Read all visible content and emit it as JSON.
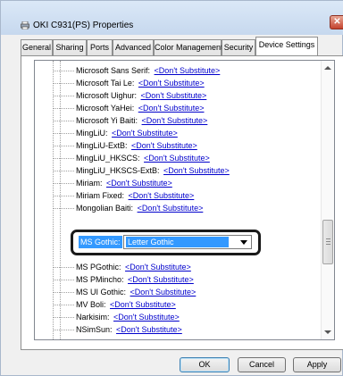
{
  "window": {
    "title": "OKI C931(PS) Properties",
    "close_label": "✕"
  },
  "tabs": [
    {
      "label": "General",
      "active": false
    },
    {
      "label": "Sharing",
      "active": false
    },
    {
      "label": "Ports",
      "active": false
    },
    {
      "label": "Advanced",
      "active": false
    },
    {
      "label": "Color Management",
      "active": false
    },
    {
      "label": "Security",
      "active": false
    },
    {
      "label": "Device Settings",
      "active": true
    }
  ],
  "font_substitution": {
    "rows_above": [
      {
        "font": "Microsoft Sans Serif:",
        "value": "<Don't Substitute>"
      },
      {
        "font": "Microsoft Tai Le:",
        "value": "<Don't Substitute>"
      },
      {
        "font": "Microsoft Uighur:",
        "value": "<Don't Substitute>"
      },
      {
        "font": "Microsoft YaHei:",
        "value": "<Don't Substitute>"
      },
      {
        "font": "Microsoft Yi Baiti:",
        "value": "<Don't Substitute>"
      },
      {
        "font": "MingLiU:",
        "value": "<Don't Substitute>"
      },
      {
        "font": "MingLiU-ExtB:",
        "value": "<Don't Substitute>"
      },
      {
        "font": "MingLiU_HKSCS:",
        "value": "<Don't Substitute>"
      },
      {
        "font": "MingLiU_HKSCS-ExtB:",
        "value": "<Don't Substitute>"
      },
      {
        "font": "Miriam:",
        "value": "<Don't Substitute>"
      },
      {
        "font": "Miriam Fixed:",
        "value": "<Don't Substitute>"
      },
      {
        "font": "Mongolian Baiti:",
        "value": "<Don't Substitute>"
      }
    ],
    "selected": {
      "font": "MS Gothic:",
      "value": "Letter Gothic"
    },
    "rows_below": [
      {
        "font": "MS PGothic:",
        "value": "<Don't Substitute>"
      },
      {
        "font": "MS PMincho:",
        "value": "<Don't Substitute>"
      },
      {
        "font": "MS UI Gothic:",
        "value": "<Don't Substitute>"
      },
      {
        "font": "MV Boli:",
        "value": "<Don't Substitute>"
      },
      {
        "font": "Narkisim:",
        "value": "<Don't Substitute>"
      },
      {
        "font": "NSimSun:",
        "value": "<Don't Substitute>"
      }
    ]
  },
  "buttons": {
    "ok": "OK",
    "cancel": "Cancel",
    "apply": "Apply"
  },
  "colors": {
    "selection": "#3399ff",
    "link": "#0000cc",
    "close_button": "#c4432e"
  }
}
